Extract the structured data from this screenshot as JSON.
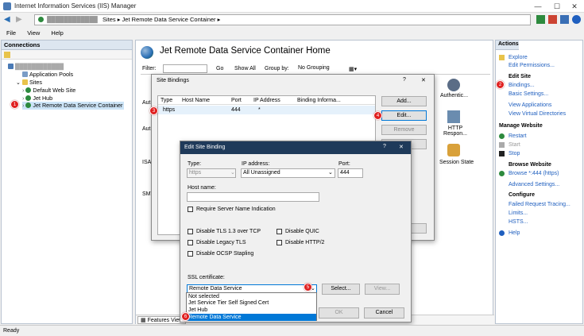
{
  "window": {
    "title": "Internet Information Services (IIS) Manager",
    "min": "—",
    "max": "☐",
    "close": "✕"
  },
  "address": {
    "path": "Sites  ▸  Jet Remote Data Service Container  ▸",
    "host": "████████████"
  },
  "menu": {
    "file": "File",
    "view": "View",
    "help": "Help"
  },
  "connections": {
    "header": "Connections",
    "tree": {
      "host": "████████████",
      "app_pools": "Application Pools",
      "sites": "Sites",
      "default_site": "Default Web Site",
      "jet_hub": "Jet Hub",
      "jet_container": "Jet Remote Data Service Container"
    }
  },
  "main": {
    "title": "Jet Remote Data Service Container Home",
    "filter_label": "Filter:",
    "go": "Go",
    "show_all": "Show All",
    "group_by_label": "Group by:",
    "group_by_value": "No Grouping",
    "side_labels": [
      "Aut",
      "Aut",
      "ISA",
      "SMT"
    ],
    "icons": {
      "authentication": "Authentic...",
      "http": "HTTP Respon...",
      "session": "Session State"
    },
    "features_view": "Features View"
  },
  "site_bindings": {
    "title": "Site Bindings",
    "help": "?",
    "close": "✕",
    "columns": [
      "Type",
      "Host Name",
      "Port",
      "IP Address",
      "Binding Informa..."
    ],
    "rows": [
      {
        "type": "https",
        "host": "",
        "port": "444",
        "ip": "*",
        "info": ""
      }
    ],
    "add": "Add...",
    "edit": "Edit...",
    "remove": "Remove"
  },
  "edit_binding": {
    "title": "Edit Site Binding",
    "help": "?",
    "close": "✕",
    "type_label": "Type:",
    "type_value": "https",
    "ip_label": "IP address:",
    "ip_value": "All Unassigned",
    "port_label": "Port:",
    "port_value": "444",
    "host_label": "Host name:",
    "host_value": "",
    "sni": "Require Server Name Indication",
    "tls13": "Disable TLS 1.3 over TCP",
    "quic": "Disable QUIC",
    "legacy": "Disable Legacy TLS",
    "http2": "Disable HTTP/2",
    "ocsp": "Disable OCSP Stapling",
    "ssl_label": "SSL certificate:",
    "ssl_value": "Remote Data Service",
    "select": "Select...",
    "view": "View...",
    "ok": "OK",
    "cancel": "Cancel",
    "options": [
      "Not selected",
      "Jet Service Tier Self Signed Cert",
      "Jet Hub",
      "Remote Data Service"
    ]
  },
  "actions": {
    "header": "Actions",
    "explore": "Explore",
    "edit_permissions": "Edit Permissions...",
    "edit_site": "Edit Site",
    "bindings": "Bindings...",
    "basic_settings": "Basic Settings...",
    "view_apps": "View Applications",
    "view_vdirs": "View Virtual Directories",
    "manage_website": "Manage Website",
    "restart": "Restart",
    "start": "Start",
    "stop": "Stop",
    "browse_website": "Browse Website",
    "browse_444": "Browse *:444 (https)",
    "advanced": "Advanced Settings...",
    "configure": "Configure",
    "failed_tracing": "Failed Request Tracing...",
    "limits": "Limits...",
    "hsts": "HSTS...",
    "help": "Help"
  },
  "status": {
    "text": "Ready"
  },
  "badges": [
    "1",
    "2",
    "3",
    "4",
    "5",
    "6"
  ],
  "colors": {
    "accent": "#0078d7",
    "badge": "#e02020",
    "link": "#1f5fbf"
  }
}
